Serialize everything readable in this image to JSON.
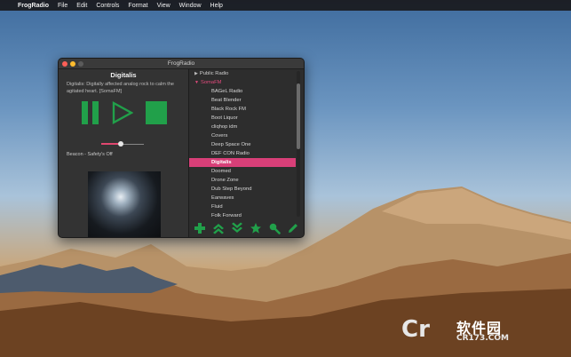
{
  "menubar": {
    "apple_glyph": "",
    "app_name": "FrogRadio",
    "items": [
      "File",
      "Edit",
      "Controls",
      "Format",
      "View",
      "Window",
      "Help"
    ]
  },
  "window": {
    "title": "FrogRadio",
    "station": {
      "name": "Digitalis",
      "description": "Digitalis: Digitally affected analog rock to calm the agitated heart. [SomaFM]"
    },
    "now_playing": "Beacon - Safety's Off",
    "volume_level": 0.45,
    "stations": [
      {
        "label": "Public Radio",
        "type": "group",
        "open": false
      },
      {
        "label": "SomaFM",
        "type": "group",
        "open": true
      },
      {
        "label": "BAGeL Radio",
        "type": "item"
      },
      {
        "label": "Beat Blender",
        "type": "item"
      },
      {
        "label": "Black Rock FM",
        "type": "item"
      },
      {
        "label": "Boot Liquor",
        "type": "item"
      },
      {
        "label": "cliqhop idm",
        "type": "item"
      },
      {
        "label": "Covers",
        "type": "item"
      },
      {
        "label": "Deep Space One",
        "type": "item"
      },
      {
        "label": "DEF CON Radio",
        "type": "item"
      },
      {
        "label": "Digitalis",
        "type": "item",
        "selected": true
      },
      {
        "label": "Doomed",
        "type": "item"
      },
      {
        "label": "Drone Zone",
        "type": "item"
      },
      {
        "label": "Dub Step Beyond",
        "type": "item"
      },
      {
        "label": "Earwaves",
        "type": "item"
      },
      {
        "label": "Fluid",
        "type": "item"
      },
      {
        "label": "Folk Forward",
        "type": "item"
      }
    ],
    "toolbar_icons": [
      "add-icon",
      "move-up-icon",
      "move-down-icon",
      "favorite-star-icon",
      "search-icon",
      "edit-pencil-icon"
    ]
  },
  "colors": {
    "accent_green": "#21a04a",
    "selection_pink": "#d83f78",
    "group_open_pink": "#e04a7c"
  },
  "watermark": {
    "logo": "Cr",
    "text": "软件园",
    "url": "CR173.COM"
  }
}
